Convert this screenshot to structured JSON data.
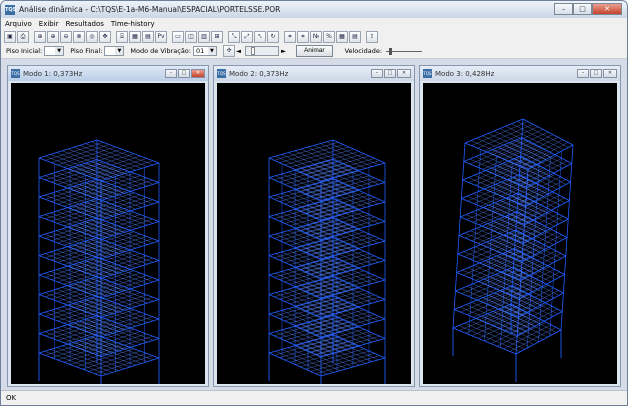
{
  "window": {
    "title": "Análise dinâmica - C:\\TQS\\E-1a-M6-Manual\\ESPACIAL\\PORTELSSE.POR",
    "controls": {
      "minimize": "–",
      "maximize": "□",
      "close": "✕"
    }
  },
  "menubar": [
    "Arquivo",
    "Exibir",
    "Resultados",
    "Time-history"
  ],
  "toolbar1": {
    "buttons": [
      {
        "name": "save-icon",
        "glyph": "▣"
      },
      {
        "name": "print-icon",
        "glyph": "⎙"
      },
      {
        "name": "zoom-icon",
        "glyph": "⊕"
      },
      {
        "name": "zoom-in-icon",
        "glyph": "⊕"
      },
      {
        "name": "zoom-out-icon",
        "glyph": "⊖"
      },
      {
        "name": "zoom-window-icon",
        "glyph": "⊗"
      },
      {
        "name": "zoom-fit-icon",
        "glyph": "◎"
      },
      {
        "name": "pan-icon",
        "glyph": "✥"
      },
      {
        "name": "structure-icon",
        "glyph": "⌸"
      },
      {
        "name": "view-icon",
        "glyph": "▦"
      },
      {
        "name": "image-icon",
        "glyph": "▤"
      },
      {
        "name": "pv-icon",
        "glyph": "Pv"
      },
      {
        "name": "layout-1-icon",
        "glyph": "▭"
      },
      {
        "name": "layout-2-icon",
        "glyph": "◫"
      },
      {
        "name": "layout-3-icon",
        "glyph": "▥"
      },
      {
        "name": "layout-4-icon",
        "glyph": "⊞"
      },
      {
        "name": "axis-x-icon",
        "glyph": "⤡"
      },
      {
        "name": "axis-y-icon",
        "glyph": "⤢"
      },
      {
        "name": "axis-z-icon",
        "glyph": "⤣"
      },
      {
        "name": "rotate-icon",
        "glyph": "↻"
      },
      {
        "name": "mesh-icon",
        "glyph": "⌗"
      },
      {
        "name": "mesh-2-icon",
        "glyph": "⌗"
      },
      {
        "name": "numbering-icon",
        "glyph": "№"
      },
      {
        "name": "percent-icon",
        "glyph": "%"
      },
      {
        "name": "table-icon",
        "glyph": "▦"
      },
      {
        "name": "report-icon",
        "glyph": "▤"
      },
      {
        "name": "export-icon",
        "glyph": "⇪"
      }
    ]
  },
  "toolbar2": {
    "piso_inicial_label": "Piso Inicial:",
    "piso_inicial_value": "",
    "piso_final_label": "Piso Final:",
    "piso_final_value": "",
    "modo_label": "Modo de Vibração:",
    "modo_value": "01",
    "animar_label": "Animar",
    "velocidade_label": "Velocidade:",
    "combo_arrow": "▼",
    "scroll_left": "◄",
    "scroll_right": "►",
    "animate_icon": "✣"
  },
  "subwindows": [
    {
      "title": "Modo 1: 0,373Hz",
      "active": true
    },
    {
      "title": "Modo 2: 0,373Hz",
      "active": false
    },
    {
      "title": "Modo 3: 0,428Hz",
      "active": false
    }
  ],
  "statusbar": {
    "text": "OK"
  },
  "colors": {
    "structure": "#1e5cff",
    "structure_light": "#5b88ff",
    "canvas": "#000000"
  }
}
